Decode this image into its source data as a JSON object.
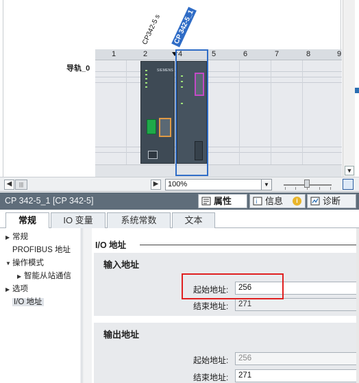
{
  "device_view": {
    "rail_label": "导轨_0",
    "slots": [
      "1",
      "2",
      "3",
      "4",
      "5",
      "6",
      "7",
      "8",
      "9"
    ],
    "cpu_tag": "CP342-5 s",
    "cp_tag": "CP 342-5_1",
    "cpu_brand": "SIEMENS",
    "zoom": "100%"
  },
  "properties": {
    "title": "CP 342-5_1 [CP 342-5]",
    "tabs": [
      {
        "label": "属性",
        "active": true
      },
      {
        "label": "信息",
        "active": false
      },
      {
        "label": "诊断",
        "active": false
      }
    ]
  },
  "sub_tabs": [
    "常规",
    "IO 变量",
    "系统常数",
    "文本"
  ],
  "tree": {
    "items": [
      {
        "label": "常规",
        "level": 0,
        "arrow": "▶"
      },
      {
        "label": "PROFIBUS 地址",
        "level": 0,
        "arrow": ""
      },
      {
        "label": "操作模式",
        "level": 0,
        "arrow": "▼"
      },
      {
        "label": "智能从站通信",
        "level": 1,
        "arrow": "▶"
      },
      {
        "label": "选项",
        "level": 0,
        "arrow": "▶"
      },
      {
        "label": "I/O 地址",
        "level": 0,
        "arrow": "",
        "selected": true
      }
    ]
  },
  "io_address": {
    "section_title": "I/O 地址",
    "input": {
      "title": "输入地址",
      "start_label": "起始地址:",
      "start_value": "256",
      "end_label": "结束地址:",
      "end_value": "271"
    },
    "output": {
      "title": "输出地址",
      "start_label": "起始地址:",
      "start_value": "256",
      "end_label": "结束地址:",
      "end_value": "271"
    }
  },
  "colors": {
    "header_bg": "#5f6d7a",
    "selection_blue": "#2f6cc6",
    "highlight_red": "#e02020"
  }
}
